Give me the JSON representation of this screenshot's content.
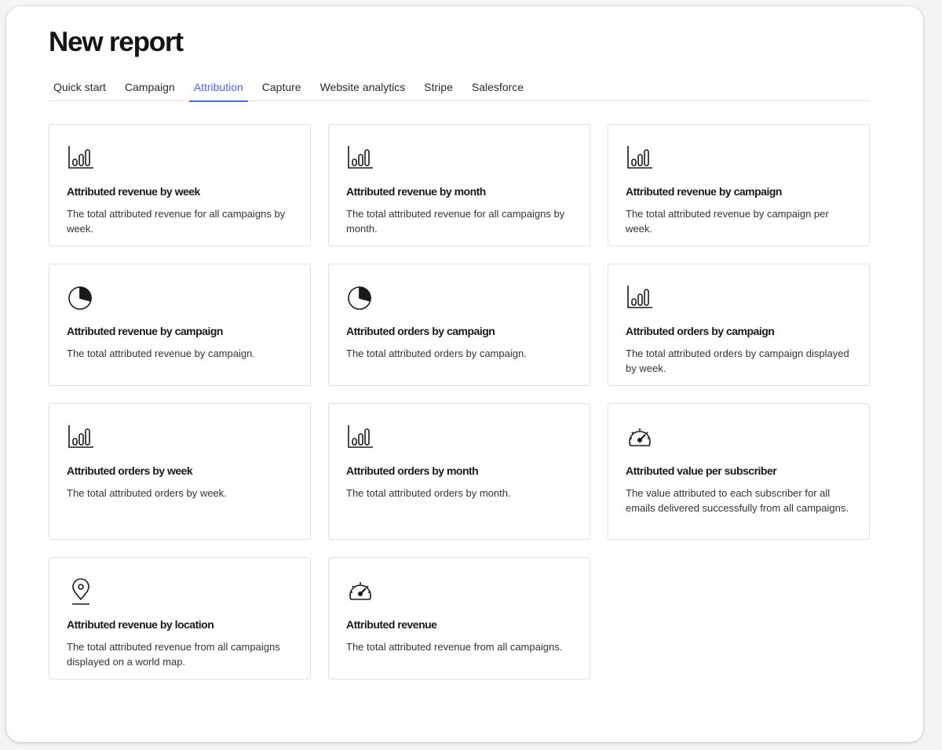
{
  "page": {
    "title": "New report"
  },
  "tabs": [
    {
      "label": "Quick start"
    },
    {
      "label": "Campaign"
    },
    {
      "label": "Attribution",
      "active": true
    },
    {
      "label": "Capture"
    },
    {
      "label": "Website analytics"
    },
    {
      "label": "Stripe"
    },
    {
      "label": "Salesforce"
    }
  ],
  "cards": [
    {
      "icon": "bar-chart-icon",
      "title": "Attributed revenue by week",
      "description": "The total attributed revenue for all campaigns by week."
    },
    {
      "icon": "bar-chart-icon",
      "title": "Attributed revenue by month",
      "description": "The total attributed revenue for all campaigns by month."
    },
    {
      "icon": "bar-chart-icon",
      "title": "Attributed revenue by campaign",
      "description": "The total attributed revenue by campaign per week."
    },
    {
      "icon": "pie-chart-icon",
      "title": "Attributed revenue by campaign",
      "description": "The total attributed revenue by campaign."
    },
    {
      "icon": "pie-chart-icon",
      "title": "Attributed orders by campaign",
      "description": "The total attributed orders by campaign."
    },
    {
      "icon": "bar-chart-icon",
      "title": "Attributed orders by campaign",
      "description": "The total attributed orders by campaign displayed by week."
    },
    {
      "icon": "bar-chart-icon",
      "title": "Attributed orders by week",
      "description": "The total attributed orders by week."
    },
    {
      "icon": "bar-chart-icon",
      "title": "Attributed orders by month",
      "description": "The total attributed orders by month."
    },
    {
      "icon": "gauge-icon",
      "title": "Attributed value per subscriber",
      "description": "The value attributed to each subscriber for all emails delivered successfully from all campaigns."
    },
    {
      "icon": "location-pin-icon",
      "title": "Attributed revenue by location",
      "description": "The total attributed revenue from all campaigns displayed on a world map."
    },
    {
      "icon": "gauge-icon",
      "title": "Attributed revenue",
      "description": "The total attributed revenue from all campaigns."
    }
  ],
  "colors": {
    "accent": "#4d63d8",
    "border": "#e0e0e0",
    "text": "#1a1a1a"
  }
}
